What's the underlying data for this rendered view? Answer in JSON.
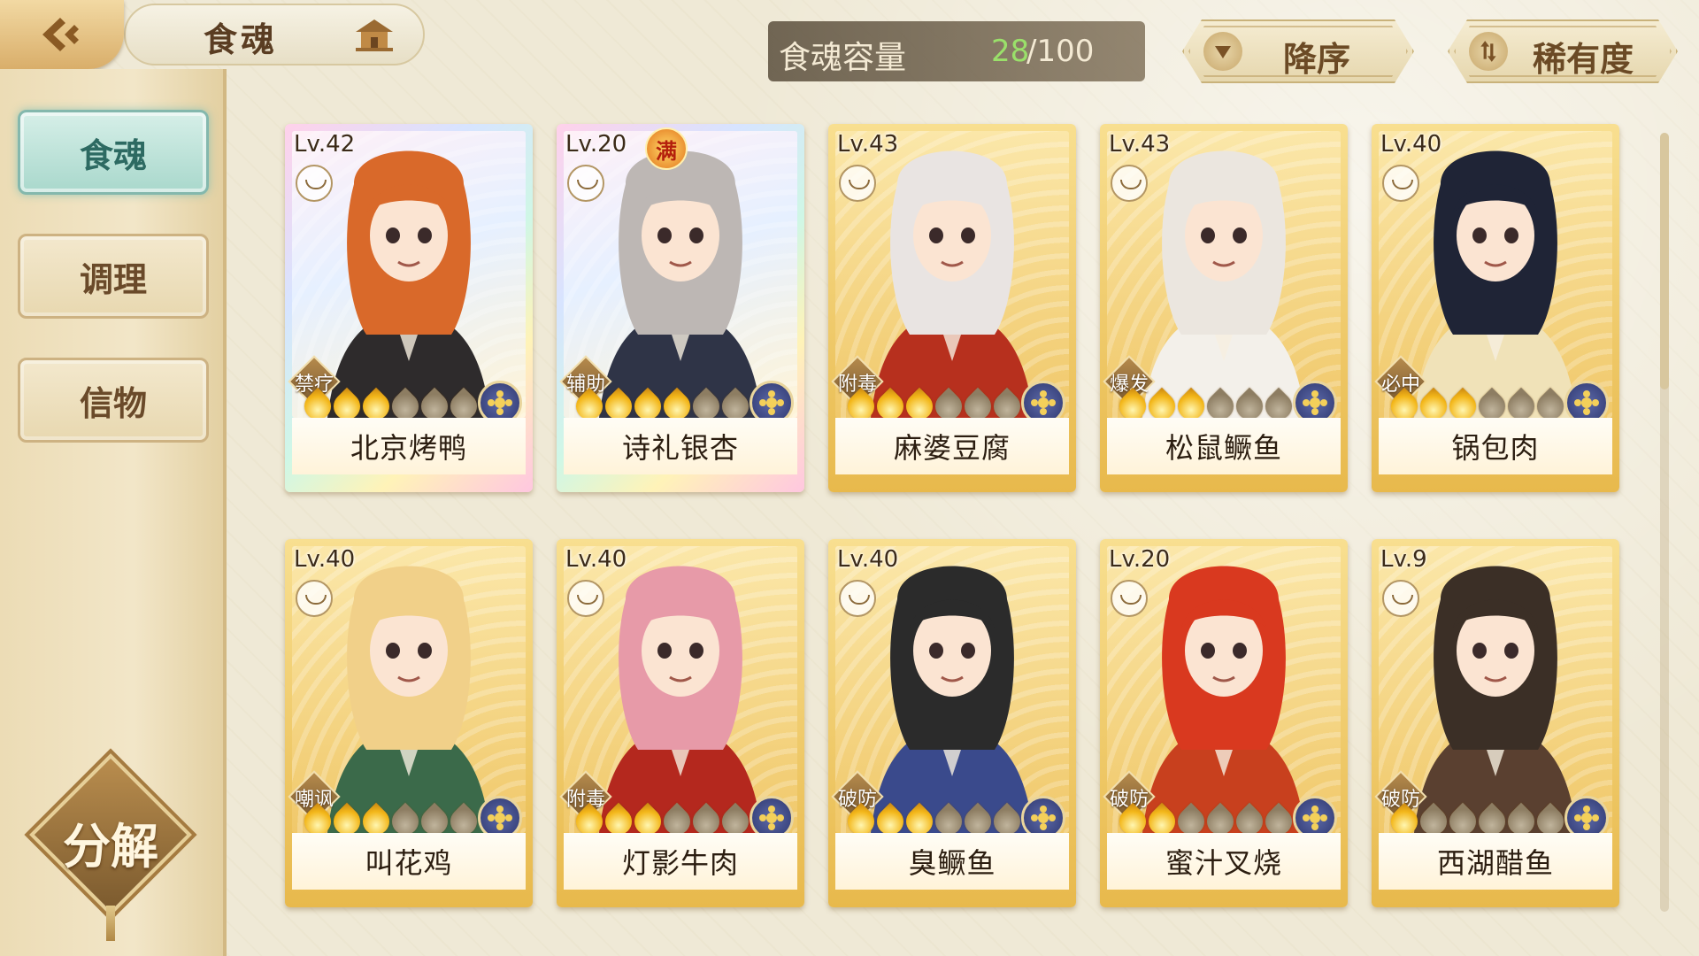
{
  "header": {
    "title": "食魂",
    "capacity_label": "食魂容量",
    "capacity_count": "28",
    "capacity_total": "/100",
    "sort_order_label": "降序",
    "sort_field_label": "稀有度"
  },
  "sidebar": {
    "items": [
      {
        "label": "食魂",
        "active": true
      },
      {
        "label": "调理",
        "active": false
      },
      {
        "label": "信物",
        "active": false
      }
    ],
    "decompose_label": "分解"
  },
  "cards": [
    {
      "level": "Lv.42",
      "name": "北京烤鸭",
      "role": "禁疗",
      "stars": 3,
      "frame": "rainbow"
    },
    {
      "level": "Lv.20",
      "name": "诗礼银杏",
      "role": "辅助",
      "stars": 4,
      "frame": "rainbow",
      "badge": "满"
    },
    {
      "level": "Lv.43",
      "name": "麻婆豆腐",
      "role": "附毒",
      "stars": 3,
      "frame": "gold"
    },
    {
      "level": "Lv.43",
      "name": "松鼠鳜鱼",
      "role": "爆发",
      "stars": 3,
      "frame": "gold"
    },
    {
      "level": "Lv.40",
      "name": "锅包肉",
      "role": "必中",
      "stars": 3,
      "frame": "gold"
    },
    {
      "level": "Lv.40",
      "name": "叫花鸡",
      "role": "嘲讽",
      "stars": 3,
      "frame": "gold"
    },
    {
      "level": "Lv.40",
      "name": "灯影牛肉",
      "role": "附毒",
      "stars": 3,
      "frame": "gold"
    },
    {
      "level": "Lv.40",
      "name": "臭鳜鱼",
      "role": "破防",
      "stars": 3,
      "frame": "gold"
    },
    {
      "level": "Lv.20",
      "name": "蜜汁叉烧",
      "role": "破防",
      "stars": 2,
      "frame": "gold"
    },
    {
      "level": "Lv.9",
      "name": "西湖醋鱼",
      "role": "破防",
      "stars": 1,
      "frame": "gold"
    }
  ],
  "colors": {
    "accent_green": "#9ae06a",
    "active_tab": "#a9d8cc",
    "card_gold": "#f0c86a"
  },
  "icons": [
    "back-arrow-icon",
    "house-icon",
    "sort-down-icon",
    "sort-swap-icon",
    "bowl-icon",
    "flame-icon",
    "element-icon"
  ]
}
